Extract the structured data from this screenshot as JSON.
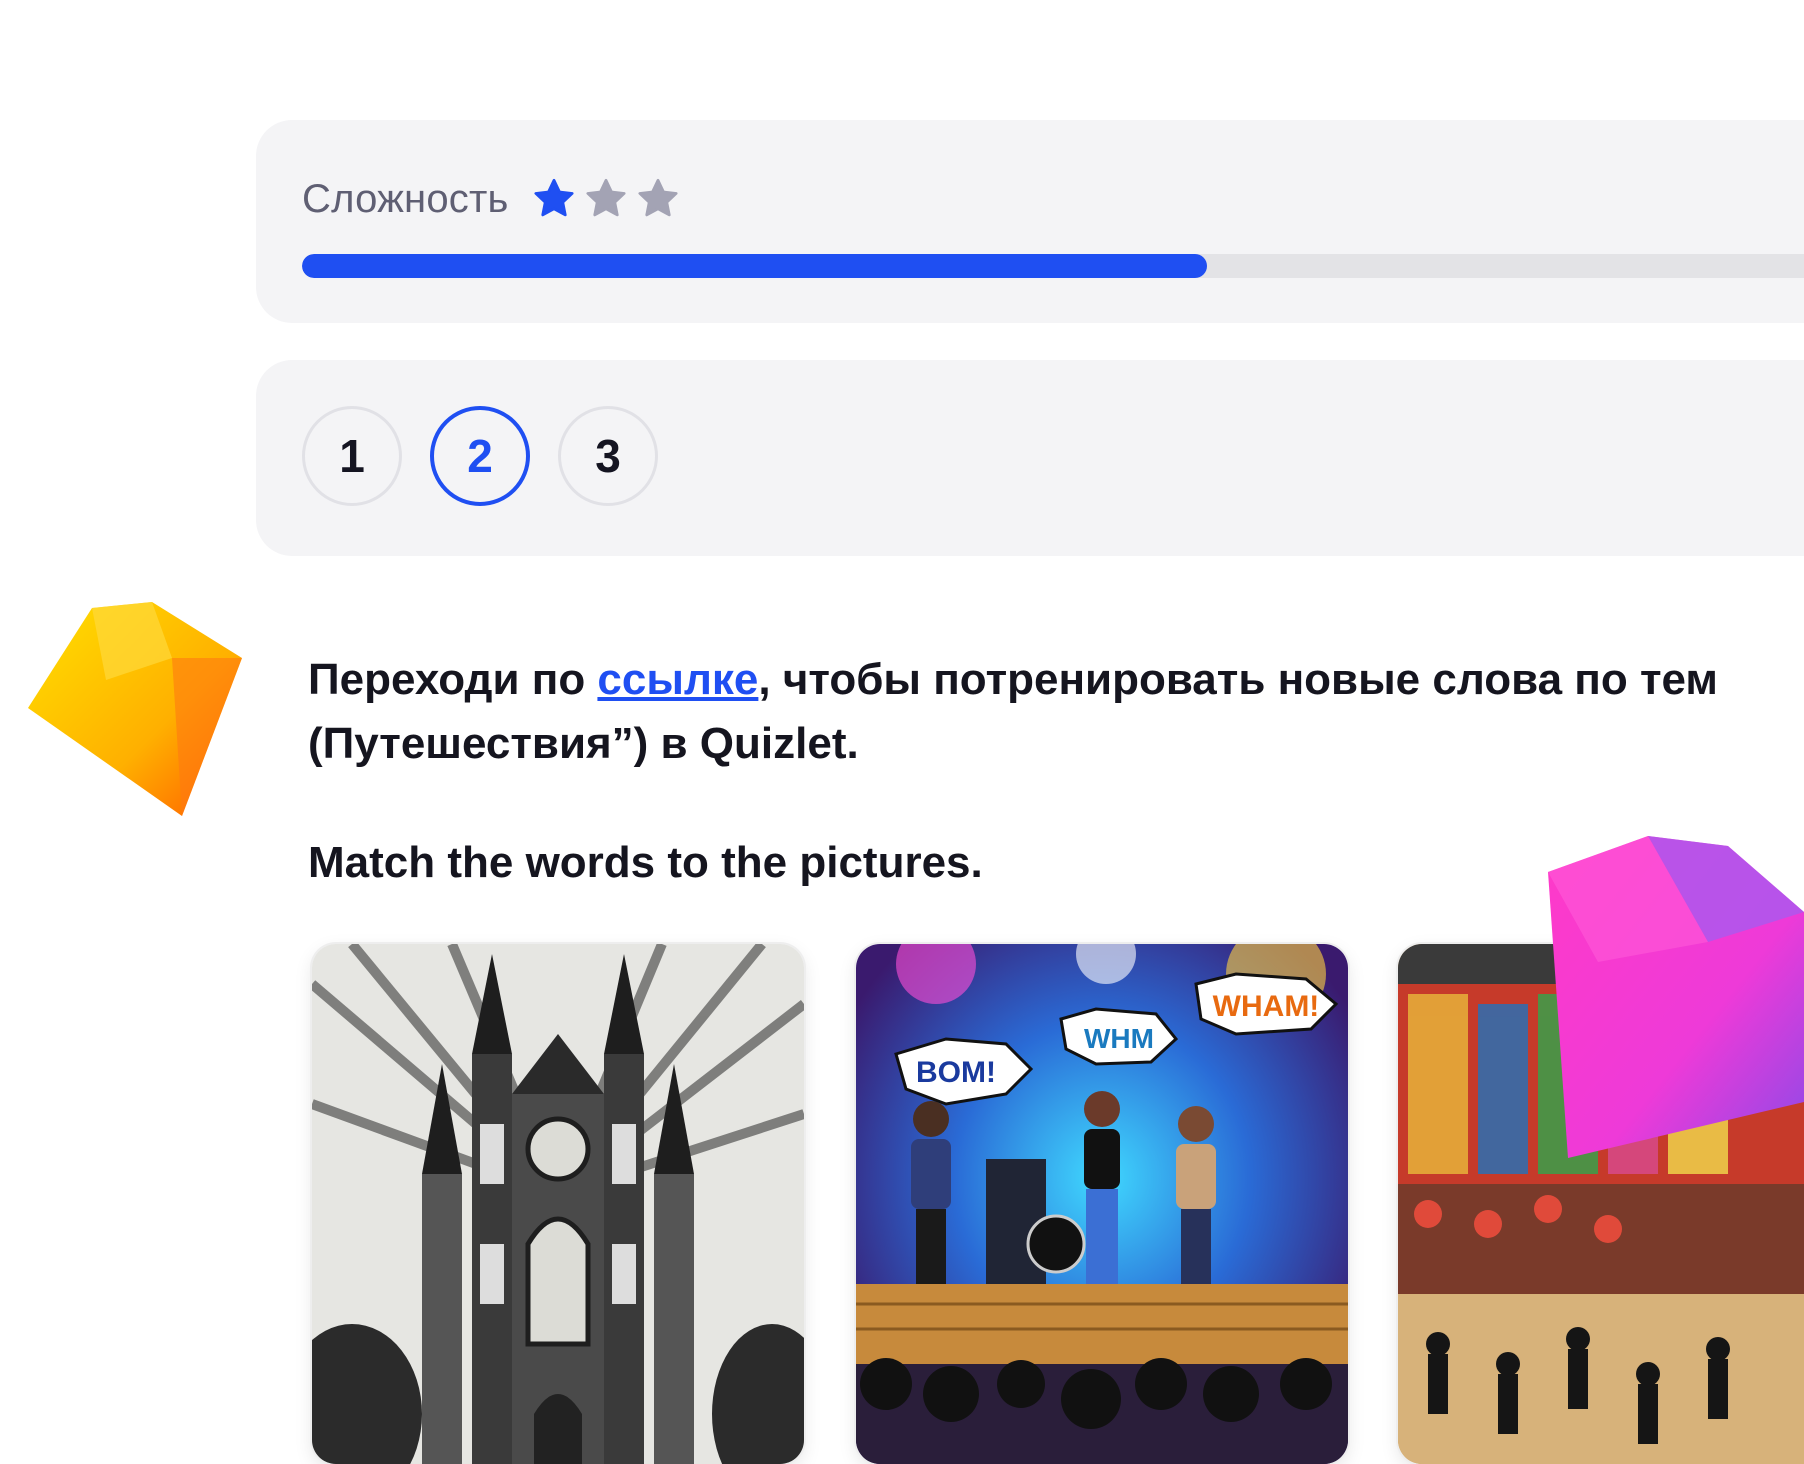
{
  "difficulty": {
    "label": "Сложность",
    "stars_filled": 1,
    "stars_total": 3,
    "progress_percent": 58,
    "accent_color": "#1f4ff2",
    "track_color": "#e3e3e6"
  },
  "steps": {
    "items": [
      "1",
      "2",
      "3"
    ],
    "active": "2"
  },
  "instruction": {
    "prefix": "Переходи по ",
    "link_text": "ссылке",
    "suffix_line1": ", чтобы потренировать новые слова по тем",
    "line2": "(Путешествия”) в Quizlet."
  },
  "task": {
    "title": "Match the words to the pictures."
  },
  "pictures": [
    {
      "subject": "gothic-cathedral"
    },
    {
      "subject": "rock-concert",
      "bubbles": [
        "BOM!",
        "WHM",
        "WHAM!"
      ]
    },
    {
      "subject": "street-festival-crowd"
    }
  ]
}
